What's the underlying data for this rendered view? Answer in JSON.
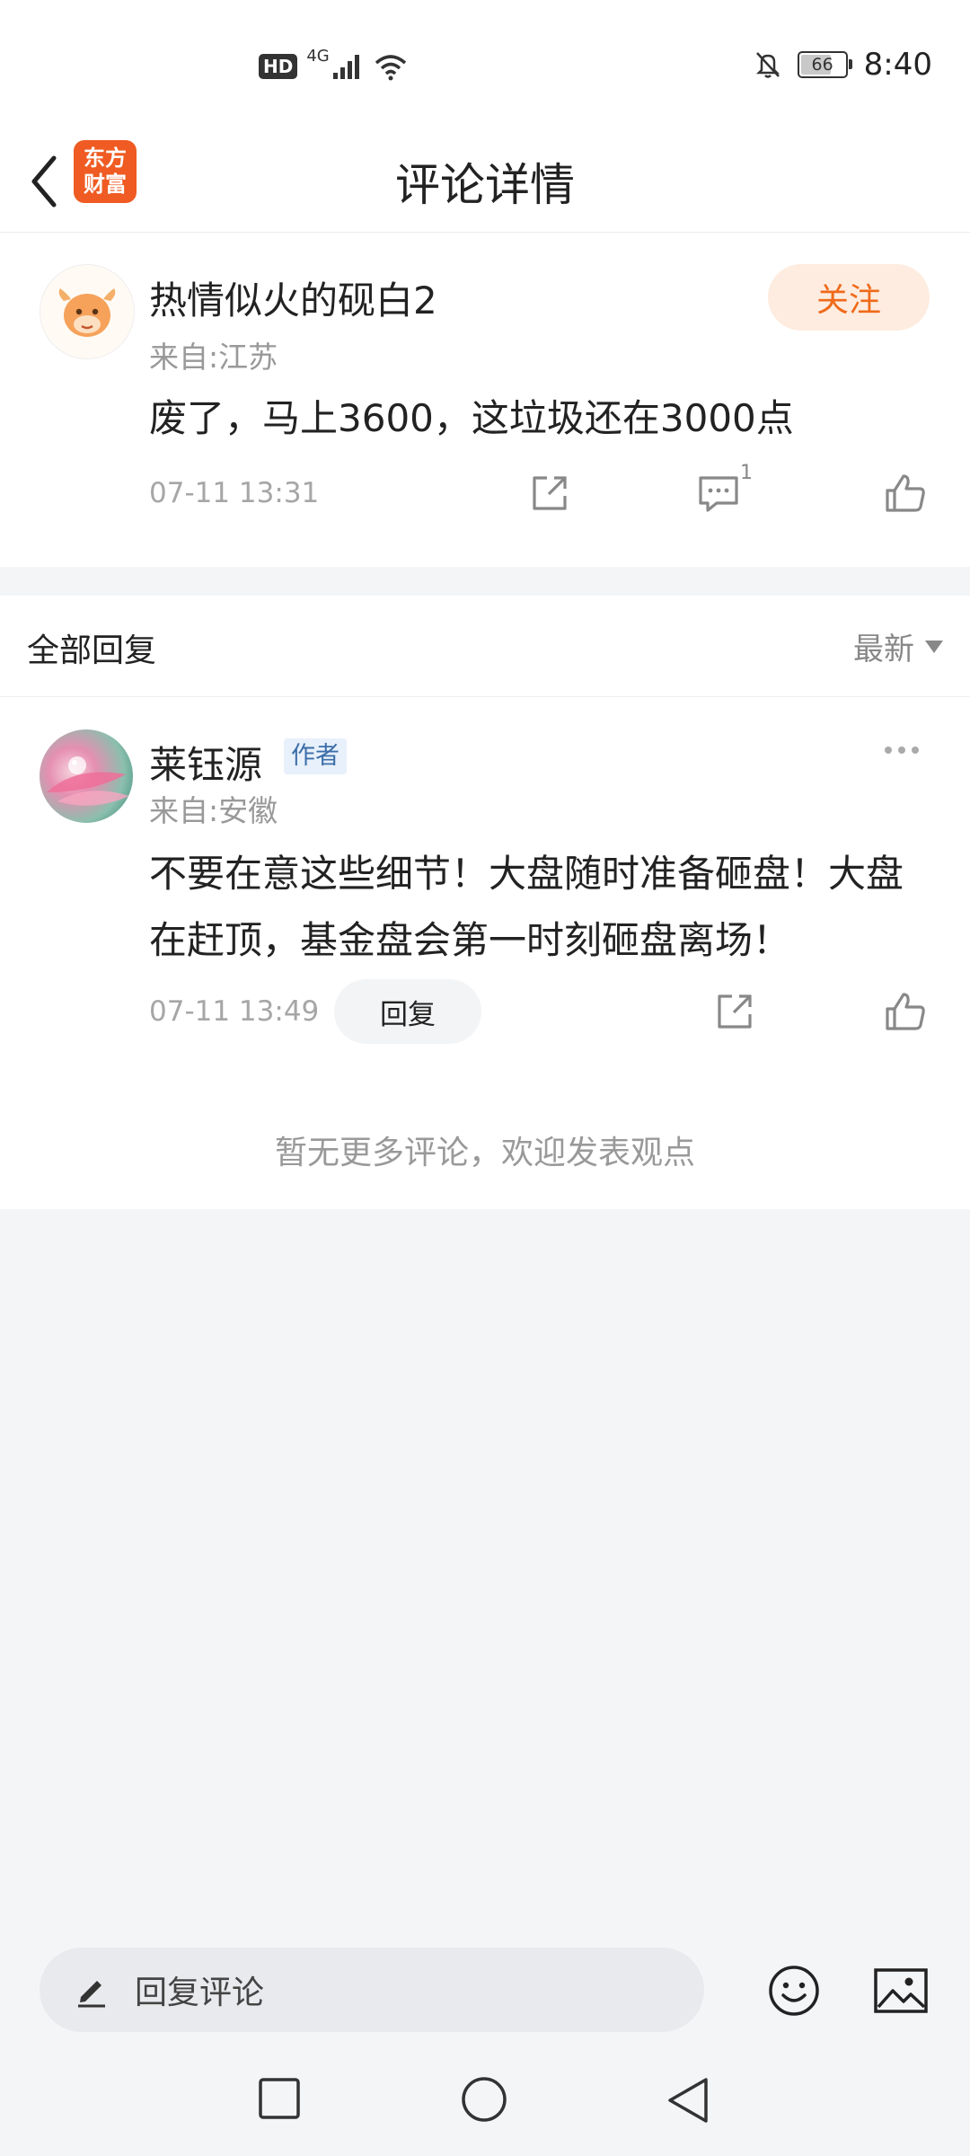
{
  "status_bar": {
    "hd": "HD",
    "network": "4G",
    "battery": "66",
    "time": "8:40"
  },
  "header": {
    "logo_line1": "东方",
    "logo_line2": "财富",
    "title": "评论详情"
  },
  "comment": {
    "username": "热情似火的砚白2",
    "from": "来自:江苏",
    "follow_label": "关注",
    "content": "废了，马上3600，这垃圾还在3000点",
    "time": "07-11 13:31",
    "reply_count": "1"
  },
  "replies": {
    "title": "全部回复",
    "sort_label": "最新",
    "items": [
      {
        "username": "莱钰源",
        "tag": "作者",
        "from": "来自:安徽",
        "content": "不要在意这些细节！大盘随时准备砸盘！大盘在赶顶，基金盘会第一时刻砸盘离场！",
        "time": "07-11 13:49",
        "reply_label": "回复"
      }
    ],
    "no_more": "暂无更多评论，欢迎发表观点"
  },
  "input": {
    "placeholder": "回复评论"
  },
  "colors": {
    "accent": "#ef6a1a",
    "follow_bg": "#fdecdf",
    "page_bg": "#f4f5f7"
  },
  "icons": [
    "back-icon",
    "share-icon",
    "comment-icon",
    "like-icon",
    "more-icon",
    "pen-icon",
    "emoji-icon",
    "image-icon",
    "nav-recent-icon",
    "nav-home-icon",
    "nav-back-icon"
  ]
}
